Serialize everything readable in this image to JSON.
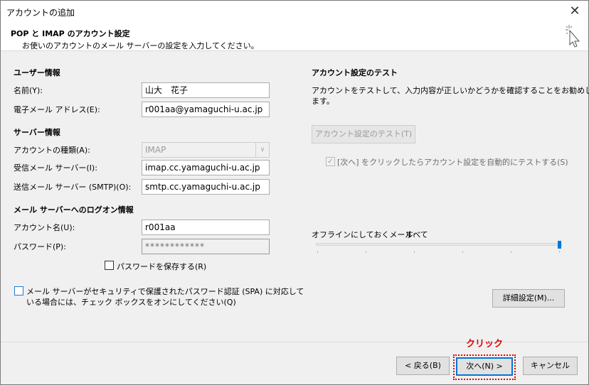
{
  "window": {
    "title": "アカウントの追加",
    "close_glyph": "✕"
  },
  "header": {
    "title": "POP と IMAP のアカウント設定",
    "subtitle": "お使いのアカウントのメール サーバーの設定を入力してください。"
  },
  "user_info": {
    "heading": "ユーザー情報",
    "name_label": "名前(Y):",
    "name_value": "山大　花子",
    "email_label": "電子メール アドレス(E):",
    "email_value": "r001aa@yamaguchi-u.ac.jp"
  },
  "server_info": {
    "heading": "サーバー情報",
    "account_type_label": "アカウントの種類(A):",
    "account_type_value": "IMAP",
    "incoming_label": "受信メール サーバー(I):",
    "incoming_value": "imap.cc.yamaguchi-u.ac.jp",
    "outgoing_label": "送信メール サーバー (SMTP)(O):",
    "outgoing_value": "smtp.cc.yamaguchi-u.ac.jp"
  },
  "logon_info": {
    "heading": "メール サーバーへのログオン情報",
    "account_name_label": "アカウント名(U):",
    "account_name_value": "r001aa",
    "password_label": "パスワード(P):",
    "password_value": "************",
    "save_password_label": "パスワードを保存する(R)",
    "spa_label_line1": "メール サーバーがセキュリティで保護されたパスワード認証 (SPA) に対応して",
    "spa_label_line2": "いる場合には、チェック ボックスをオンにしてください(Q)"
  },
  "test_section": {
    "heading": "アカウント設定のテスト",
    "desc_line1": "アカウントをテストして、入力内容が正しいかどうかを確認することをお勧めし",
    "desc_line2": "ます。",
    "test_button": "アカウント設定のテスト(T)",
    "auto_test_label": "[次へ] をクリックしたらアカウント設定を自動的にテストする(S)",
    "auto_test_check": "✓"
  },
  "offline": {
    "label": "オフラインにしておくメール:",
    "value": "すべて",
    "slider_level": 1.0
  },
  "buttons": {
    "advanced": "詳細設定(M)...",
    "back": "< 戻る(B)",
    "next": "次へ(N) >",
    "cancel": "キャンセル"
  },
  "annotation": {
    "click_label": "クリック"
  }
}
